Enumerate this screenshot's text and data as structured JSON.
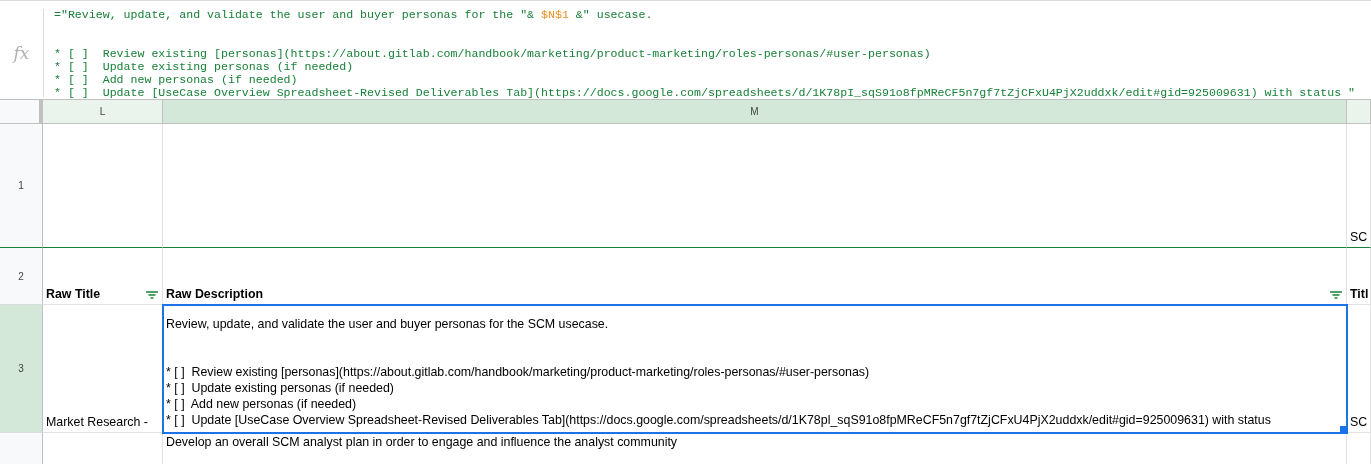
{
  "formula_bar": {
    "icon_label": "fx",
    "lines": [
      {
        "segments": [
          {
            "kind": "text",
            "text": "=\"Review, update, and validate the user and buyer personas for the \"& "
          },
          {
            "kind": "reference",
            "text": "$N$1"
          },
          {
            "kind": "text",
            "text": " &\" usecase."
          }
        ]
      },
      {
        "segments": [
          {
            "kind": "text",
            "text": "* [ ]  Review existing [personas](https://about.gitlab.com/handbook/marketing/product-marketing/roles-personas/#user-personas)"
          }
        ]
      },
      {
        "segments": [
          {
            "kind": "text",
            "text": "* [ ]  Update existing personas (if needed)"
          }
        ]
      },
      {
        "segments": [
          {
            "kind": "text",
            "text": "* [ ]  Add new personas (if needed)"
          }
        ]
      },
      {
        "segments": [
          {
            "kind": "text",
            "text": "* [ ]  Update [UseCase Overview Spreadsheet-Revised Deliverables Tab](https://docs.google.com/spreadsheets/d/1K78pI_sqS91o8fpMReCF5n7gf7tZjCFxU4PjX2uddxk/edit#gid=925009631) with status \""
          }
        ]
      }
    ]
  },
  "columns": [
    {
      "label": "L",
      "selected": false
    },
    {
      "label": "M",
      "selected": true
    },
    {
      "selected": false
    }
  ],
  "rows": [
    {
      "label": "1",
      "selected": false,
      "frozen_below": true,
      "cells": [
        {},
        {},
        {
          "text": "SC"
        }
      ]
    },
    {
      "label": "2",
      "selected": false,
      "frozen_below": false,
      "cells": [
        {
          "text": "Raw Title",
          "header": true,
          "filter": true
        },
        {
          "text": "Raw Description",
          "header": true,
          "filter": true
        },
        {
          "text": "Titl",
          "header": true,
          "filter": false
        }
      ]
    },
    {
      "label": "3",
      "selected": true,
      "frozen_below": false,
      "cells": [
        {
          "text": "Market Research -"
        },
        {
          "paragraphs": [
            [
              "Review, update, and validate the user and buyer personas for the SCM usecase."
            ],
            [
              "* [ ]  Review existing [personas](https://about.gitlab.com/handbook/marketing/product-marketing/roles-personas/#user-personas)",
              "* [ ]  Update existing personas (if needed)",
              "* [ ]  Add new personas (if needed)",
              "* [ ]  Update [UseCase Overview Spreadsheet-Revised Deliverables Tab](https://docs.google.com/spreadsheets/d/1K78pl_sqS91o8fpMReCF5n7gf7tZjCFxU4PjX2uddxk/edit#gid=925009631) with status"
            ]
          ],
          "selected": true
        },
        {
          "text": "SC"
        }
      ]
    },
    {
      "selected": false,
      "cells": [
        {},
        {
          "text": "Develop an overall SCM analyst plan in order to engage and influence the analyst community"
        },
        {}
      ]
    }
  ]
}
